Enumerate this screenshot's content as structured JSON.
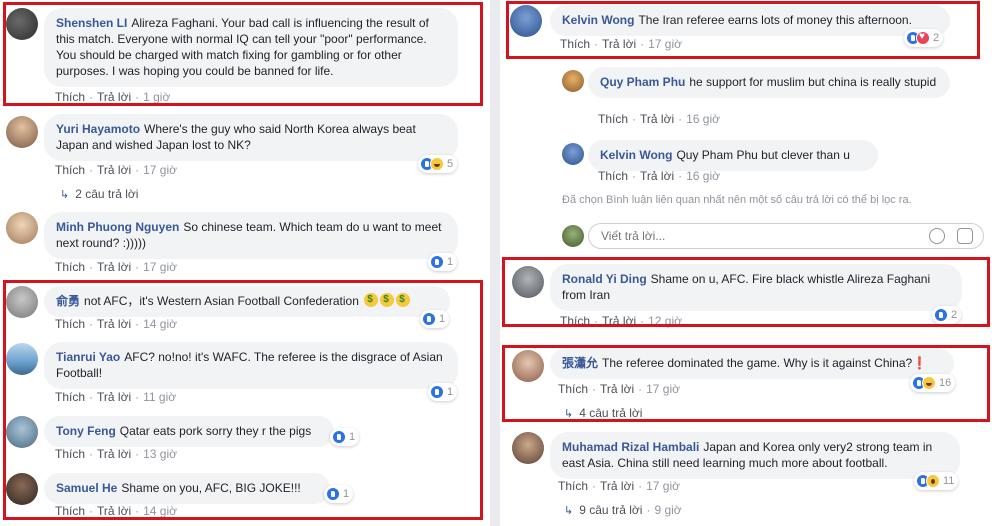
{
  "labels": {
    "like": "Thích",
    "reply": "Trả lời"
  },
  "left": [
    {
      "name": "Shenshen LI",
      "text": "Alireza Faghani. Your bad call is influencing the result of this match. Everyone with normal IQ can tell your \"poor\" performance. You should be charged with match fixing for gambling or for other purposes. I was hoping you could be banned for life.",
      "time": "1 giờ"
    },
    {
      "name": "Yuri Hayamoto",
      "text": "Where's the guy who said North Korea always beat Japan and wished Japan lost to NK?",
      "time": "17 giờ",
      "reactions": "5",
      "replies": "2 câu trả lời"
    },
    {
      "name": "Minh Phuong Nguyen",
      "text": "So chinese team. Which team do u want to meet next round? :)))))",
      "time": "17 giờ",
      "reactions": "1"
    },
    {
      "name": "俞勇",
      "text": "not AFC，it's Western Asian Football Confederation",
      "time": "14 giờ",
      "reactions": "1"
    },
    {
      "name": "Tianrui Yao",
      "text": "AFC? no!no! it's WAFC. The referee is the disgrace of Asian Football!",
      "time": "11 giờ",
      "reactions": "1"
    },
    {
      "name": "Tony Feng",
      "text": "Qatar eats pork sorry they r the pigs",
      "time": "13 giờ",
      "reactions": "1"
    },
    {
      "name": "Samuel He",
      "text": "Shame on you, AFC, BIG JOKE!!!",
      "time": "14 giờ",
      "reactions": "1"
    }
  ],
  "right": [
    {
      "name": "Kelvin Wong",
      "text": "The Iran referee earns lots of money this afternoon.",
      "time": "17 giờ",
      "reactions": "2"
    },
    {
      "name": "Quy Pham Phu",
      "text": "he support for muslim but china is really stupid",
      "time": "16 giờ"
    },
    {
      "name": "Kelvin Wong",
      "text": "Quy Pham Phu but clever than u",
      "time": "16 giờ"
    },
    {
      "name": "Ronald Yi Ding",
      "text": "Shame on u, AFC. Fire black whistle Alireza Faghani from Iran",
      "time": "12 giờ",
      "reactions": "2"
    },
    {
      "name": "張瀟允",
      "text": "The referee dominated the game. Why is it against China?❗",
      "time": "17 giờ",
      "reactions": "16",
      "replies": "4 câu trả lời"
    },
    {
      "name": "Muhamad Rizal Hambali",
      "text": "Japan and Korea only very2 strong team in east Asia. China still need learning much more about football.",
      "time": "17 giờ",
      "reactions": "11",
      "replies": "9 câu trả lời",
      "replies_time": "9 giờ"
    }
  ],
  "filter_notice": "Đã chọn Bình luận liên quan nhất nên một số câu trả lời có thể bị lọc ra.",
  "reply_placeholder": "Viết trả lời...",
  "colors": {
    "highlight": "#d4141d",
    "name": "#385898",
    "bubble": "#f2f3f5"
  }
}
